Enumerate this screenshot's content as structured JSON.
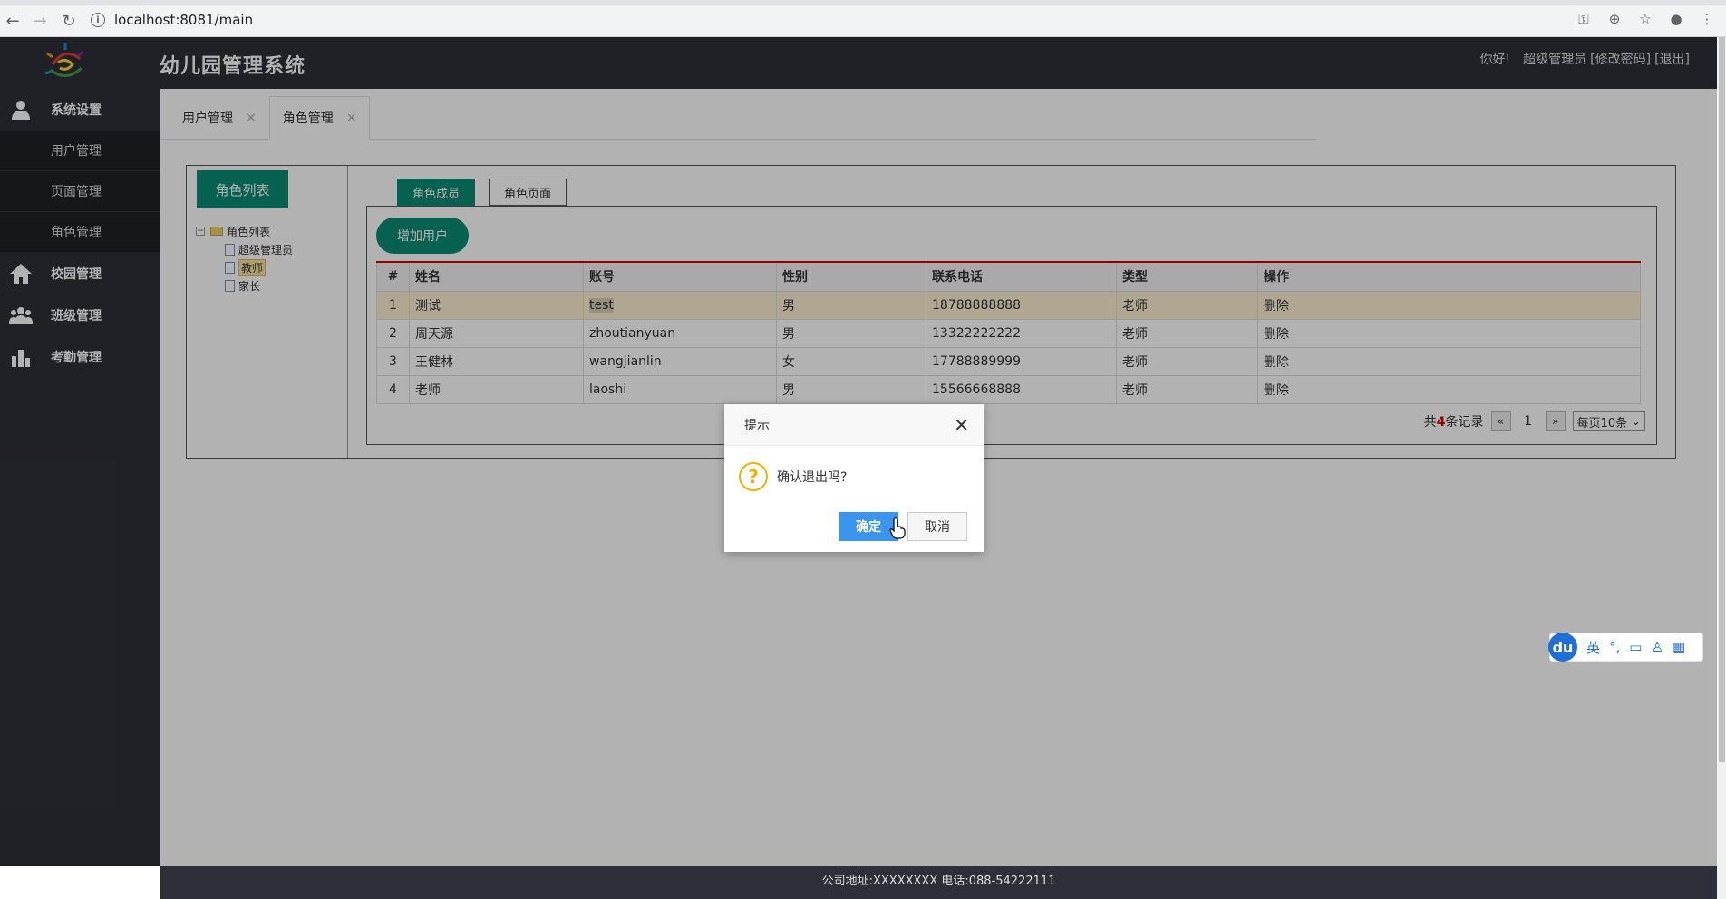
{
  "browser": {
    "url": "localhost:8081/main"
  },
  "header": {
    "title": "幼儿园管理系统",
    "greeting": "你好!",
    "user": "超级管理员",
    "change_password": "[修改密码]",
    "logout": "[退出]"
  },
  "sidebar": {
    "groups": [
      {
        "label": "系统设置",
        "icon": "user-icon"
      },
      {
        "label": "校园管理",
        "icon": "home-icon"
      },
      {
        "label": "班级管理",
        "icon": "group-icon"
      },
      {
        "label": "考勤管理",
        "icon": "bar-chart-icon"
      }
    ],
    "sub_items": [
      "用户管理",
      "页面管理",
      "角色管理"
    ]
  },
  "tabs": [
    {
      "label": "用户管理",
      "close": "×"
    },
    {
      "label": "角色管理",
      "close": "×"
    }
  ],
  "left_panel": {
    "button": "角色列表",
    "tree_root": "角色列表",
    "tree_children": [
      "超级管理员",
      "教师",
      "家长"
    ]
  },
  "inner_tabs": [
    "角色成员",
    "角色页面"
  ],
  "add_user_button": "增加用户",
  "table": {
    "headers": [
      "#",
      "姓名",
      "账号",
      "性别",
      "联系电话",
      "类型",
      "操作"
    ],
    "rows": [
      {
        "num": "1",
        "name": "测试",
        "account": "test",
        "gender": "男",
        "phone": "18788888888",
        "type": "老师",
        "action": "删除"
      },
      {
        "num": "2",
        "name": "周天源",
        "account": "zhoutianyuan",
        "gender": "男",
        "phone": "13322222222",
        "type": "老师",
        "action": "删除"
      },
      {
        "num": "3",
        "name": "王健林",
        "account": "wangjianlin",
        "gender": "女",
        "phone": "17788889999",
        "type": "老师",
        "action": "删除"
      },
      {
        "num": "4",
        "name": "老师",
        "account": "laoshi",
        "gender": "男",
        "phone": "15566668888",
        "type": "老师",
        "action": "删除"
      }
    ]
  },
  "pager": {
    "prefix": "共",
    "count": "4",
    "suffix": "条记录",
    "prev": "«",
    "page": "1",
    "next": "»",
    "per_page": "每页10条"
  },
  "modal": {
    "title": "提示",
    "message": "确认退出吗?",
    "ok": "确定",
    "cancel": "取消"
  },
  "footer": {
    "text": "公司地址:XXXXXXXX 电话:088-54222111"
  },
  "ime": {
    "badge": "du",
    "lang": "英"
  },
  "colors": {
    "sidebar": "#2d3038",
    "accent": "#0a8c75",
    "primary_button": "#3b95ed",
    "danger_text": "#dd0000"
  }
}
